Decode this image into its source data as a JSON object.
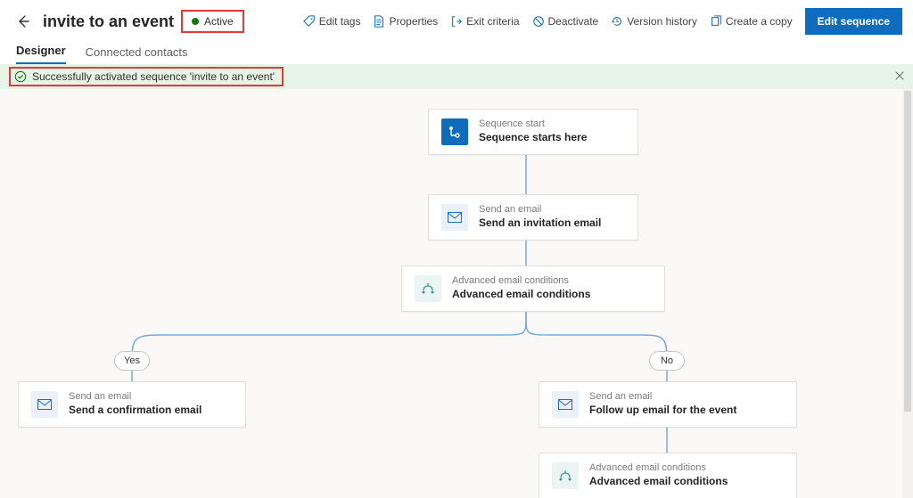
{
  "header": {
    "title": "invite to an event",
    "status": "Active",
    "actions": {
      "edit_tags": "Edit tags",
      "properties": "Properties",
      "exit_criteria": "Exit criteria",
      "deactivate": "Deactivate",
      "version_history": "Version history",
      "create_copy": "Create a copy",
      "edit_sequence": "Edit sequence"
    }
  },
  "tabs": {
    "designer": "Designer",
    "connected": "Connected contacts"
  },
  "banner": {
    "message": "Successfully activated sequence 'invite to an event'"
  },
  "flow": {
    "start": {
      "sub": "Sequence start",
      "title": "Sequence starts here"
    },
    "email1": {
      "sub": "Send an email",
      "title": "Send an invitation email"
    },
    "cond1": {
      "sub": "Advanced email conditions",
      "title": "Advanced email conditions"
    },
    "branch_yes": "Yes",
    "branch_no": "No",
    "email_yes": {
      "sub": "Send an email",
      "title": "Send a confirmation email"
    },
    "email_no": {
      "sub": "Send an email",
      "title": "Follow up email for the event"
    },
    "cond2": {
      "sub": "Advanced email conditions",
      "title": "Advanced email conditions"
    }
  }
}
